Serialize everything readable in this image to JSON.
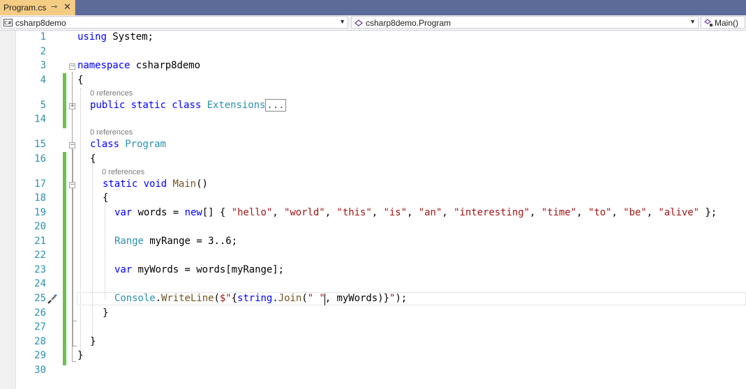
{
  "tab": {
    "title": "Program.cs",
    "pin": "⊸",
    "close": "✕"
  },
  "nav": {
    "project": "csharp8demo",
    "project_icon": "C#",
    "class": "csharp8demo.Program",
    "member": "Main()"
  },
  "refs": "0 references",
  "lines": {
    "n1": "1",
    "n2": "2",
    "n3": "3",
    "n4": "4",
    "n5": "5",
    "n14": "14",
    "n15": "15",
    "n16": "16",
    "n17": "17",
    "n18": "18",
    "n19": "19",
    "n20": "20",
    "n21": "21",
    "n22": "22",
    "n23": "23",
    "n24": "24",
    "n25": "25",
    "n26": "26",
    "n27": "27",
    "n28": "28",
    "n29": "29",
    "n30": "30"
  },
  "code": {
    "using_kw": "using",
    "using_rest": " System;",
    "ns_kw": "namespace",
    "ns_name": " csharp8demo",
    "brace_open": "{",
    "brace_close": "}",
    "ext_kw": "public static class ",
    "ext_name": "Extensions",
    "ext_collapsed": "...",
    "class_kw": "class ",
    "class_name": "Program",
    "main_kw": "static void ",
    "main_name": "Main",
    "main_parens": "()",
    "var_kw": "var",
    "words_decl": " words = ",
    "new_kw": "new",
    "arr_open": "[] { ",
    "s1": "\"hello\"",
    "s2": "\"world\"",
    "s3": "\"this\"",
    "s4": "\"is\"",
    "s5": "\"an\"",
    "s6": "\"interesting\"",
    "s7": "\"time\"",
    "s8": "\"to\"",
    "s9": "\"be\"",
    "s10": "\"alive\"",
    "comma": ", ",
    "arr_close": " };",
    "range_type": "Range",
    "range_rest": " myRange = 3..6;",
    "mywords_rest": " myWords = words[myRange];",
    "console": "Console",
    "dot": ".",
    "writeline": "WriteLine",
    "wl_open": "(",
    "interp_start": "$\"",
    "interp_brace": "{",
    "string_kw": "string",
    "join": "Join",
    "join_open": "(",
    "space_str": "\" \"",
    "join_rest": ", myWords)",
    "interp_end_brace": "}",
    "interp_close": "\"",
    "wl_close": ");"
  }
}
